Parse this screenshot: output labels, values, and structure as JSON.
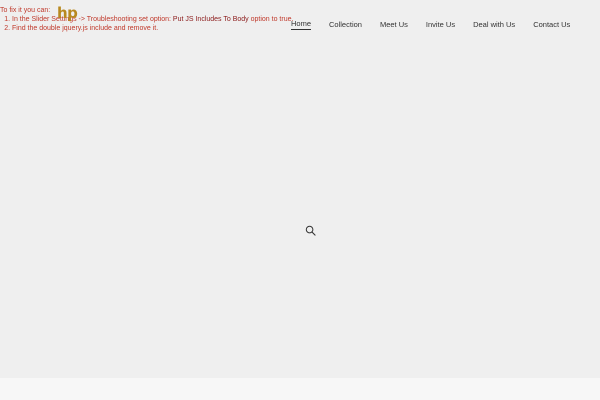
{
  "logo": {
    "text": "hp"
  },
  "nav": {
    "items": [
      {
        "label": "Home",
        "active": true
      },
      {
        "label": "Collection"
      },
      {
        "label": "Meet Us"
      },
      {
        "label": "Invite Us"
      },
      {
        "label": "Deal with Us"
      },
      {
        "label": "Contact Us"
      }
    ]
  },
  "error": {
    "title": "To fix it you can:",
    "step1_prefix": "In the Slider Settings -> Troubleshooting set option:",
    "step1_option": "Put JS Includes To Body",
    "step1_suffix": "option to true.",
    "step2": "Find the double jquery.js include and remove it."
  },
  "icons": {
    "search": "search-icon"
  },
  "colors": {
    "background": "#efefef",
    "logo": "#b8891f",
    "error_text": "#c0392b",
    "nav_text": "#333333"
  }
}
